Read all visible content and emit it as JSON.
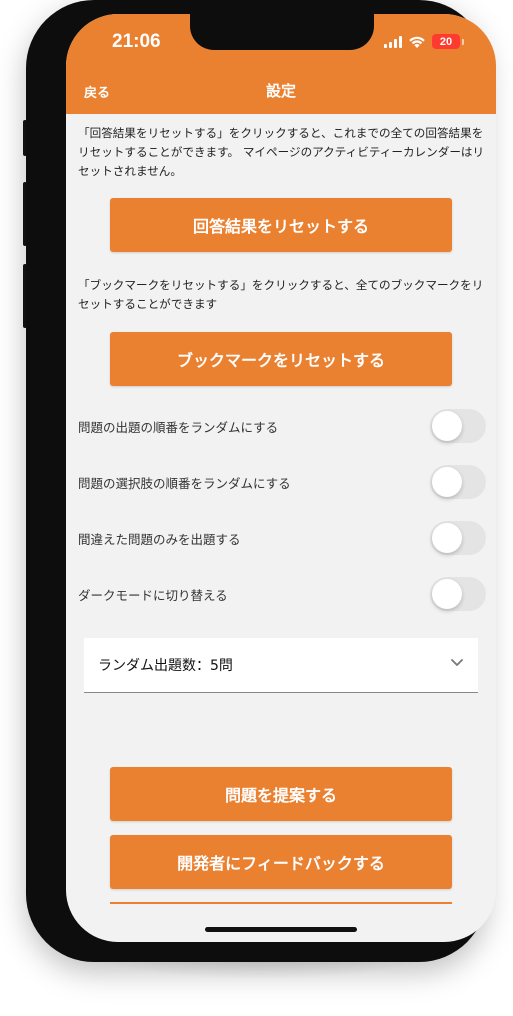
{
  "status_bar": {
    "time": "21:06",
    "battery": "20"
  },
  "header": {
    "back_label": "戻る",
    "title": "設定"
  },
  "reset_answers": {
    "description": "「回答結果をリセットする」をクリックすると、これまでの全ての回答結果をリセットすることができます。 マイページのアクティビティーカレンダーはリセットされません。",
    "button_label": "回答結果をリセットする"
  },
  "reset_bookmarks": {
    "description": "「ブックマークをリセットする」をクリックすると、全てのブックマークをリセットすることができます",
    "button_label": "ブックマークをリセットする"
  },
  "settings": [
    {
      "label": "問題の出題の順番をランダムにする",
      "enabled": false
    },
    {
      "label": "問題の選択肢の順番をランダムにする",
      "enabled": false
    },
    {
      "label": "間違えた問題のみを出題する",
      "enabled": false
    },
    {
      "label": "ダークモードに切り替える",
      "enabled": false
    }
  ],
  "random_count_select": {
    "value": "ランダム出題数：5問"
  },
  "actions": {
    "suggest_label": "問題を提案する",
    "feedback_label": "開発者にフィードバックする"
  },
  "colors": {
    "accent": "#ea8131",
    "battery_low": "#ff3b30"
  }
}
